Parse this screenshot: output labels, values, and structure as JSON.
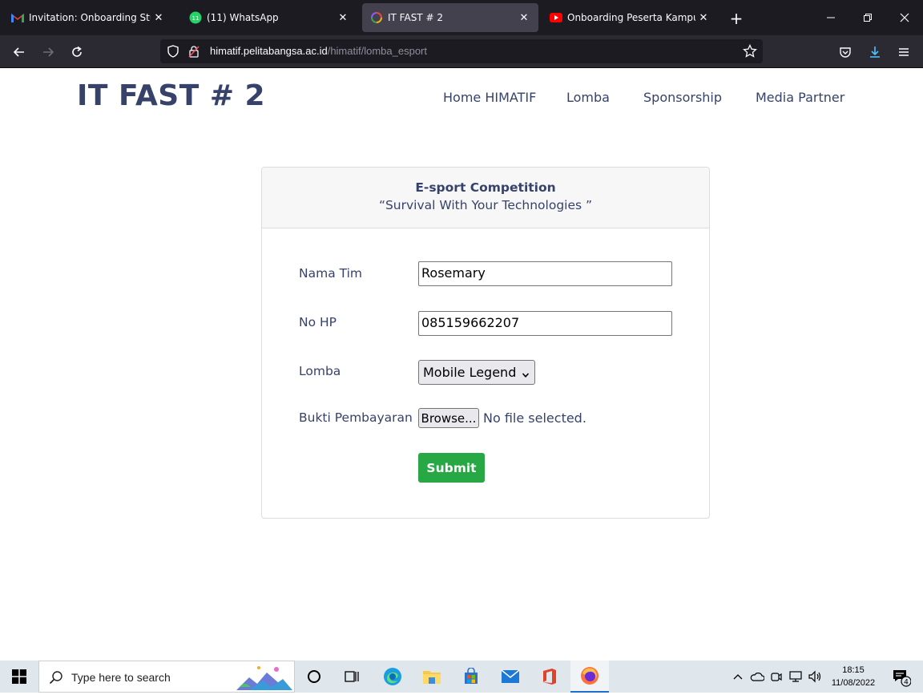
{
  "browser": {
    "tabs": [
      {
        "title": "Invitation: Onboarding Student",
        "icon": "gmail-icon",
        "active": false
      },
      {
        "title": "(11) WhatsApp",
        "icon": "whatsapp-icon",
        "active": false
      },
      {
        "title": "IT FAST # 2",
        "icon": "site-icon",
        "active": true
      },
      {
        "title": "Onboarding Peserta Kampus M",
        "icon": "youtube-icon",
        "active": false
      }
    ],
    "url_host": "himatif.pelitabangsa.ac.id",
    "url_path": "/himatif/lomba_esport"
  },
  "site": {
    "brand": "IT FAST # 2",
    "nav": [
      "Home HIMATIF",
      "Lomba",
      "Sponsorship",
      "Media Partner"
    ]
  },
  "form": {
    "title": "E-sport Competition",
    "subtitle": "“Survival With Your Technologies ”",
    "team_label": "Nama Tim",
    "team_value": "Rosemary",
    "phone_label": "No HP",
    "phone_value": "085159662207",
    "lomba_label": "Lomba",
    "lomba_value": "Mobile Legend",
    "proof_label": "Bukti Pembayaran",
    "browse_label": "Browse...",
    "no_file_text": "No file selected.",
    "submit_label": "Submit"
  },
  "taskbar": {
    "search_placeholder": "Type here to search",
    "time": "18:15",
    "date": "11/08/2022",
    "notification_count": "4"
  },
  "colors": {
    "brand_navy": "#37426a",
    "submit_green": "#28a745"
  }
}
